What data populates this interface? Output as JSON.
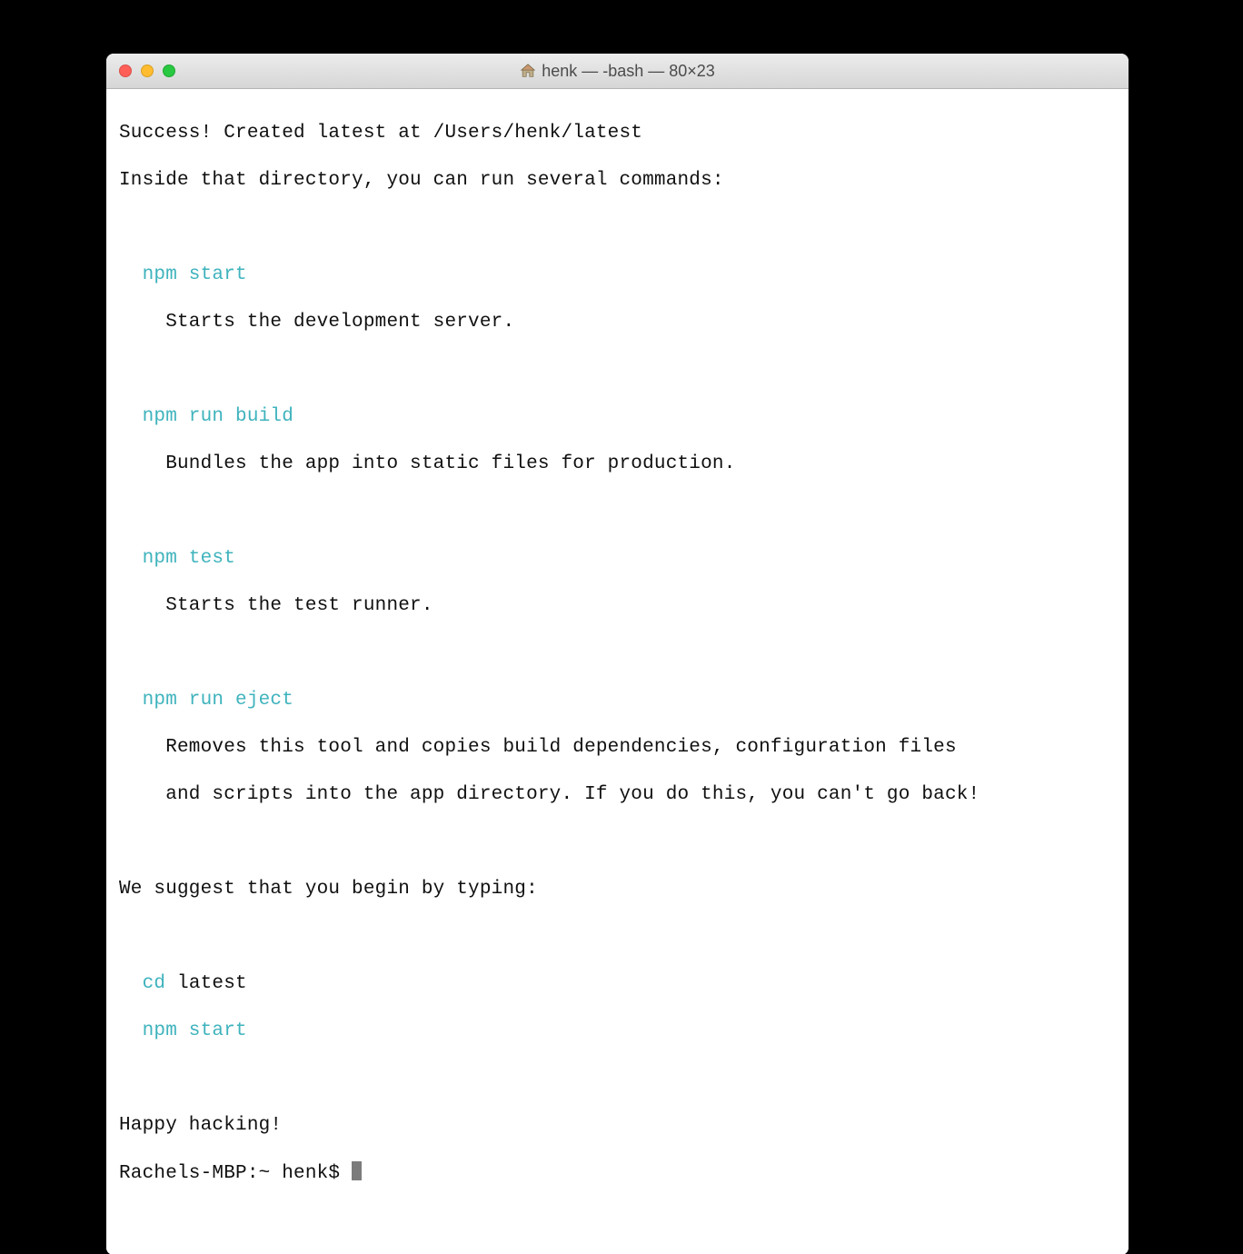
{
  "window": {
    "title": "henk — -bash — 80×23"
  },
  "colors": {
    "cyan": "#3fb3bd"
  },
  "terminal": {
    "l1": "Success! Created latest at /Users/henk/latest",
    "l2": "Inside that directory, you can run several commands:",
    "cmd1": "  npm start",
    "cmd1_desc": "    Starts the development server.",
    "cmd2": "  npm run build",
    "cmd2_desc": "    Bundles the app into static files for production.",
    "cmd3": "  npm test",
    "cmd3_desc": "    Starts the test runner.",
    "cmd4": "  npm run eject",
    "cmd4_desc_a": "    Removes this tool and copies build dependencies, configuration files",
    "cmd4_desc_b": "    and scripts into the app directory. If you do this, you can't go back!",
    "suggest": "We suggest that you begin by typing:",
    "cd_cmd": "  cd",
    "cd_arg": " latest",
    "start2": "  npm start",
    "happy": "Happy hacking!",
    "prompt": "Rachels-MBP:~ henk$ "
  }
}
